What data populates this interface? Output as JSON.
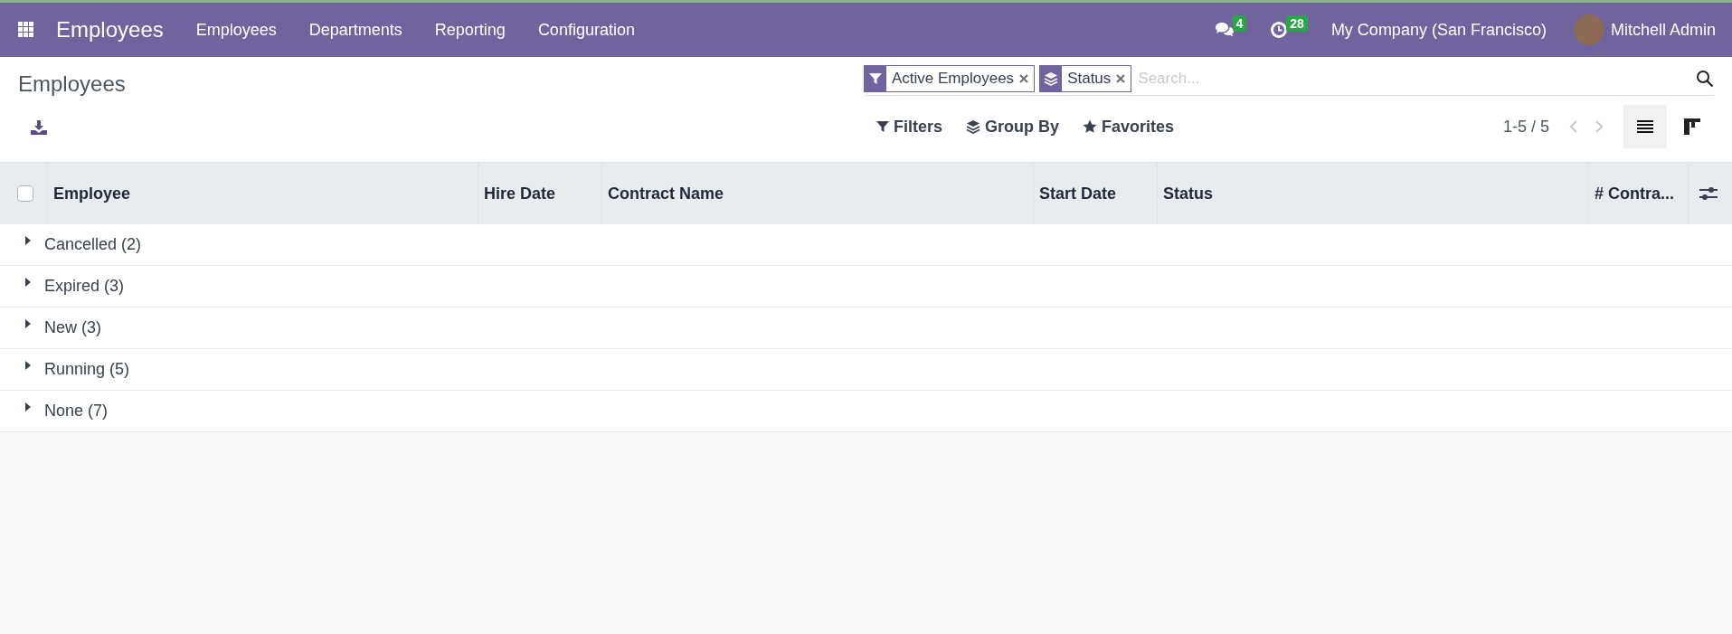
{
  "navbar": {
    "app_name": "Employees",
    "menu": [
      "Employees",
      "Departments",
      "Reporting",
      "Configuration"
    ],
    "messages_count": "4",
    "activities_count": "28",
    "company": "My Company (San Francisco)",
    "user": "Mitchell Admin"
  },
  "breadcrumb": "Employees",
  "search": {
    "facets": [
      {
        "kind": "filter",
        "label": "Active Employees"
      },
      {
        "kind": "group",
        "label": "Status"
      }
    ],
    "placeholder": "Search..."
  },
  "search_options": [
    "Filters",
    "Group By",
    "Favorites"
  ],
  "pager": "1-5 / 5",
  "views": [
    {
      "kind": "list",
      "selected": true
    },
    {
      "kind": "kanban",
      "selected": false
    }
  ],
  "table": {
    "select_all_checked": false,
    "columns": [
      "Employee",
      "Hire Date",
      "Contract Name",
      "Start Date",
      "Status",
      "# Contra..."
    ],
    "groups": [
      {
        "label": "Cancelled (2)",
        "expanded": false
      },
      {
        "label": "Expired (3)",
        "expanded": false
      },
      {
        "label": "New (3)",
        "expanded": false
      },
      {
        "label": "Running (5)",
        "expanded": false
      },
      {
        "label": "None (7)",
        "expanded": false
      }
    ]
  }
}
